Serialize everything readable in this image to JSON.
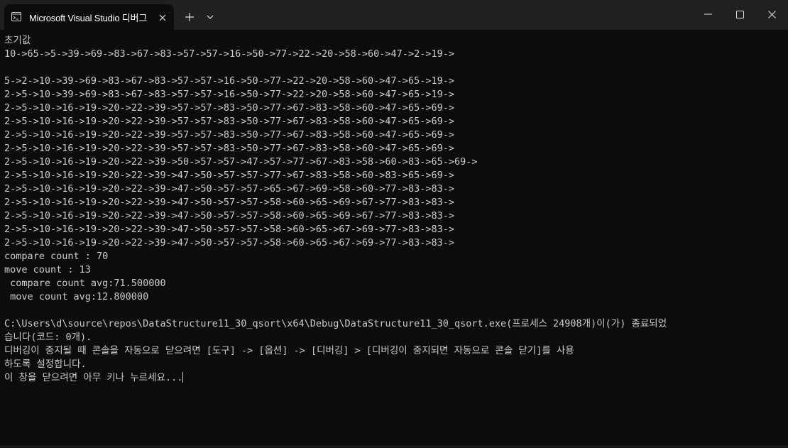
{
  "window": {
    "tab_title": "Microsoft Visual Studio 디버그",
    "icons": {
      "tab": "terminal-icon",
      "close_tab": "close-icon",
      "new_tab": "plus-icon",
      "dropdown": "chevron-down-icon",
      "minimize": "minimize-icon",
      "maximize": "maximize-icon",
      "close": "close-icon"
    }
  },
  "console": {
    "lines": [
      "초기값",
      "10->65->5->39->69->83->67->83->57->57->16->50->77->22->20->58->60->47->2->19->",
      "",
      "5->2->10->39->69->83->67->83->57->57->16->50->77->22->20->58->60->47->65->19->",
      "2->5->10->39->69->83->67->83->57->57->16->50->77->22->20->58->60->47->65->19->",
      "2->5->10->16->19->20->22->39->57->57->83->50->77->67->83->58->60->47->65->69->",
      "2->5->10->16->19->20->22->39->57->57->83->50->77->67->83->58->60->47->65->69->",
      "2->5->10->16->19->20->22->39->57->57->83->50->77->67->83->58->60->47->65->69->",
      "2->5->10->16->19->20->22->39->57->57->83->50->77->67->83->58->60->47->65->69->",
      "2->5->10->16->19->20->22->39->50->57->57->47->57->77->67->83->58->60->83->65->69->",
      "2->5->10->16->19->20->22->39->47->50->57->57->77->67->83->58->60->83->65->69->",
      "2->5->10->16->19->20->22->39->47->50->57->57->65->67->69->58->60->77->83->83->",
      "2->5->10->16->19->20->22->39->47->50->57->57->58->60->65->69->67->77->83->83->",
      "2->5->10->16->19->20->22->39->47->50->57->57->58->60->65->69->67->77->83->83->",
      "2->5->10->16->19->20->22->39->47->50->57->57->58->60->65->67->69->77->83->83->",
      "2->5->10->16->19->20->22->39->47->50->57->57->58->60->65->67->69->77->83->83->",
      "compare count : 70",
      "move count : 13",
      " compare count avg:71.500000",
      " move count avg:12.800000",
      "",
      "C:\\Users\\d\\source\\repos\\DataStructure11_30_qsort\\x64\\Debug\\DataStructure11_30_qsort.exe(프로세스 24908개)이(가) 종료되었",
      "습니다(코드: 0개).",
      "디버깅이 중지될 때 콘솔을 자동으로 닫으려면 [도구] -> [옵션] -> [디버깅] > [디버깅이 중지되면 자동으로 콘솔 닫기]를 사용",
      "하도록 설정합니다.",
      "이 창을 닫으려면 아무 키나 누르세요..."
    ]
  }
}
